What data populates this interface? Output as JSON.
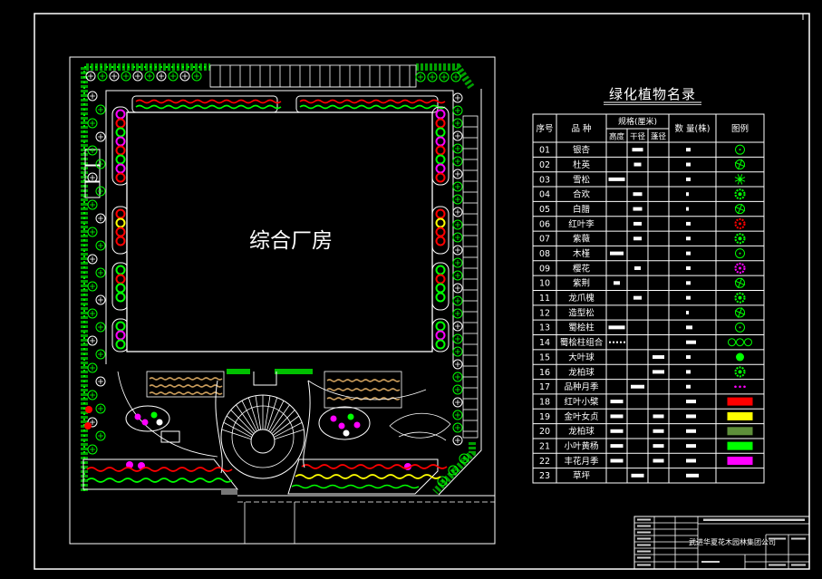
{
  "drawing": {
    "building_label": "综合厂房",
    "colors": {
      "background": "#000000",
      "linework": "#ffffff",
      "shrub_green": "#00ff00",
      "hedge_green": "#00a000",
      "flower_red": "#ff0000",
      "flower_magenta": "#ff00ff",
      "flower_yellow": "#ffff00",
      "paving_tan": "#c89b5a"
    }
  },
  "plant_list": {
    "title": "绿化植物名录",
    "headers": {
      "no": "序号",
      "species": "品 种",
      "spec": "规格(厘米)",
      "height": "高度",
      "trunk_diameter": "干径",
      "crown_diameter": "蓬径",
      "quantity": "数 量(株)",
      "legend": "图例"
    },
    "rows": [
      {
        "no": "01",
        "species": "银杏",
        "legend": {
          "icon": "ring-tree-icon",
          "color": "#00ff00"
        }
      },
      {
        "no": "02",
        "species": "杜英",
        "legend": {
          "icon": "star-tree-icon",
          "color": "#00ff00"
        }
      },
      {
        "no": "03",
        "species": "雪松",
        "legend": {
          "icon": "conifer-icon",
          "color": "#00ff00"
        }
      },
      {
        "no": "04",
        "species": "合欢",
        "legend": {
          "icon": "dense-shrub-icon",
          "color": "#00ff00"
        }
      },
      {
        "no": "05",
        "species": "白腊",
        "legend": {
          "icon": "star-tree-icon",
          "color": "#00ff00"
        }
      },
      {
        "no": "06",
        "species": "红叶李",
        "legend": {
          "icon": "flower-icon",
          "color": "#ff0000"
        }
      },
      {
        "no": "07",
        "species": "紫薇",
        "legend": {
          "icon": "dense-shrub-icon",
          "color": "#00ff00"
        }
      },
      {
        "no": "08",
        "species": "木槿",
        "legend": {
          "icon": "ring-tree-icon",
          "color": "#00ff00"
        }
      },
      {
        "no": "09",
        "species": "樱花",
        "legend": {
          "icon": "flower-icon",
          "color": "#ff00ff"
        }
      },
      {
        "no": "10",
        "species": "紫荆",
        "legend": {
          "icon": "star-tree-icon",
          "color": "#00ff00"
        }
      },
      {
        "no": "11",
        "species": "龙爪槐",
        "legend": {
          "icon": "dense-shrub-icon",
          "color": "#00ff00"
        }
      },
      {
        "no": "12",
        "species": "造型松",
        "legend": {
          "icon": "star-tree-icon",
          "color": "#00ff00"
        }
      },
      {
        "no": "13",
        "species": "蜀桧柱",
        "legend": {
          "icon": "ring-tree-icon",
          "color": "#00ff00"
        }
      },
      {
        "no": "14",
        "species": "蜀桧柱组合",
        "legend": {
          "icon": "cluster-icon",
          "color": "#00ff00"
        }
      },
      {
        "no": "15",
        "species": "大叶球",
        "legend": {
          "icon": "filled-circle-icon",
          "color": "#00ff00"
        }
      },
      {
        "no": "16",
        "species": "龙柏球",
        "legend": {
          "icon": "dense-shrub-icon",
          "color": "#00ff00"
        }
      },
      {
        "no": "17",
        "species": "品种月季",
        "legend": {
          "icon": "dot-group-icon",
          "color": "#ff00ff"
        }
      },
      {
        "no": "18",
        "species": "红叶小檗",
        "legend": {
          "icon": "swatch",
          "color": "#ff0000"
        }
      },
      {
        "no": "19",
        "species": "金叶女贞",
        "legend": {
          "icon": "swatch",
          "color": "#ffff00"
        }
      },
      {
        "no": "20",
        "species": "龙柏球",
        "legend": {
          "icon": "swatch",
          "color": "#5e8f3a"
        }
      },
      {
        "no": "21",
        "species": "小叶黄杨",
        "legend": {
          "icon": "swatch",
          "color": "#00ff00"
        }
      },
      {
        "no": "22",
        "species": "丰花月季",
        "legend": {
          "icon": "swatch",
          "color": "#ff00ff"
        }
      },
      {
        "no": "23",
        "species": "草坪",
        "legend": null
      }
    ]
  },
  "title_block": {
    "company": "武进华夏花木园林集团公司"
  }
}
